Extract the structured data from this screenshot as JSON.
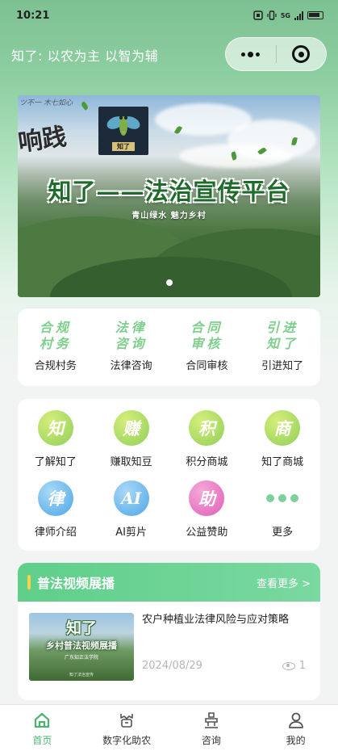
{
  "status_bar": {
    "time": "10:21",
    "network": "5G"
  },
  "nav": {
    "title": "知了: 以农为主 以智为辅"
  },
  "banner": {
    "scribble": "ツ不一 木七如心",
    "corner_text": "响践",
    "logo_text": "知了",
    "headline": "知了——法治宣传平台",
    "subline": "青山绿水  魅力乡村",
    "pages": 1,
    "active_page": 0
  },
  "services": [
    {
      "logo": "合规村务",
      "label": "合规村务"
    },
    {
      "logo": "法律咨询",
      "label": "法律咨询"
    },
    {
      "logo": "合同审核",
      "label": "合同审核"
    },
    {
      "logo": "引进知了",
      "label": "引进知了"
    }
  ],
  "grid": [
    {
      "glyph": "知",
      "label": "了解知了",
      "color_from": "#d6ee7a",
      "color_to": "#8fcf5a"
    },
    {
      "glyph": "赚",
      "label": "赚取知豆",
      "color_from": "#d6ee7a",
      "color_to": "#8fcf5a"
    },
    {
      "glyph": "积",
      "label": "积分商城",
      "color_from": "#d6ee7a",
      "color_to": "#8fcf5a"
    },
    {
      "glyph": "商",
      "label": "知了商城",
      "color_from": "#d6ee7a",
      "color_to": "#8fcf5a"
    },
    {
      "glyph": "律",
      "label": "律师介绍",
      "color_from": "#a8d9f7",
      "color_to": "#4fa6e6"
    },
    {
      "glyph": "AI",
      "label": "AI剪片",
      "color_from": "#a8d9f7",
      "color_to": "#4fa6e6"
    },
    {
      "glyph": "助",
      "label": "公益赞助",
      "color_from": "#f5a8d8",
      "color_to": "#e05fb8"
    },
    {
      "glyph": "",
      "label": "更多",
      "color_from": "",
      "color_to": ""
    }
  ],
  "video_section": {
    "title": "普法视频展播",
    "more": "查看更多 >",
    "items": [
      {
        "thumb_title": "知了",
        "thumb_subtitle": "乡村普法视频展播",
        "thumb_org": "广东知正法学院",
        "thumb_footer": "知了法治宣传",
        "title": "农户种植业法律风险与应对策略",
        "date": "2024/08/29",
        "views": "1"
      }
    ]
  },
  "tabbar": [
    {
      "icon": "home-icon",
      "label": "首页",
      "active": true
    },
    {
      "icon": "digital-farm-icon",
      "label": "数字化助农",
      "active": false
    },
    {
      "icon": "consult-icon",
      "label": "咨询",
      "active": false
    },
    {
      "icon": "profile-icon",
      "label": "我的",
      "active": false
    }
  ],
  "colors": {
    "accent": "#4db370",
    "header_green": "#5fcf8a"
  }
}
